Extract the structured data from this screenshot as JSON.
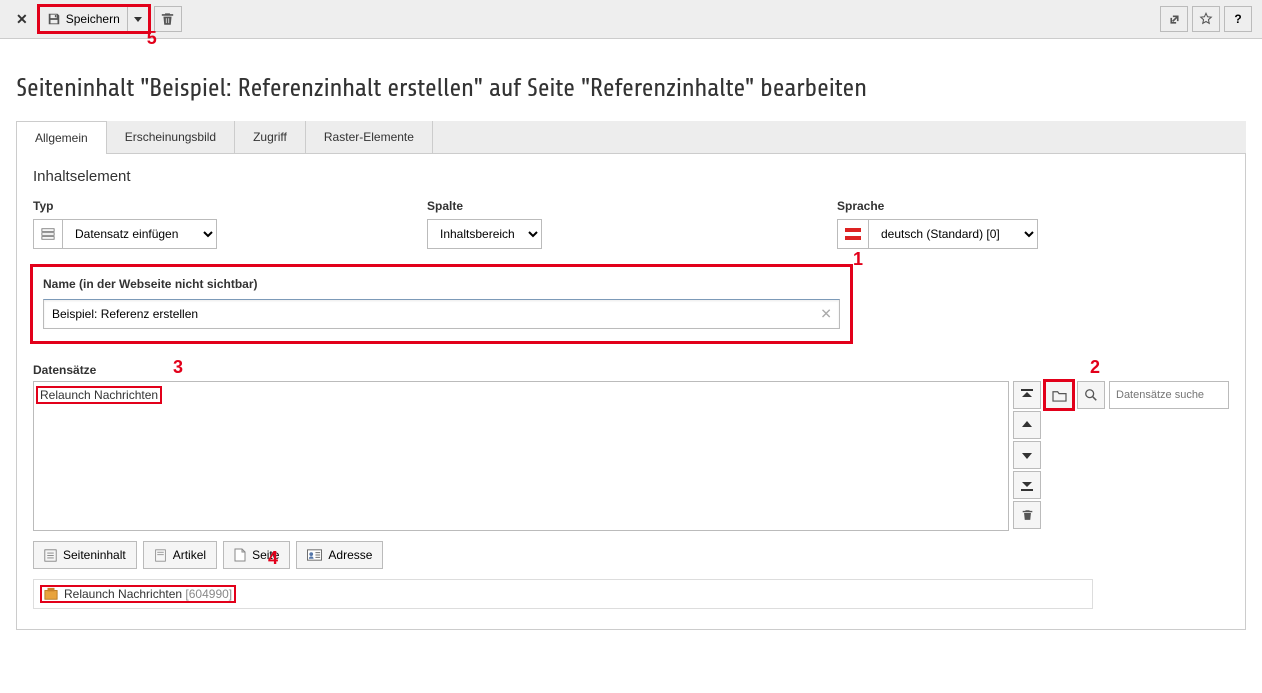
{
  "toolbar": {
    "save_label": "Speichern"
  },
  "page_title": "Seiteninhalt \"Beispiel: Referenzinhalt erstellen\" auf Seite \"Referenzinhalte\" bearbeiten",
  "tabs": [
    "Allgemein",
    "Erscheinungsbild",
    "Zugriff",
    "Raster-Elemente"
  ],
  "section_heading": "Inhaltselement",
  "fields": {
    "type_label": "Typ",
    "type_value": "Datensatz einfügen",
    "column_label": "Spalte",
    "column_value": "Inhaltsbereich",
    "language_label": "Sprache",
    "language_value": "deutsch (Standard) [0]"
  },
  "name": {
    "label": "Name (in der Webseite nicht sichtbar)",
    "value": "Beispiel: Referenz erstellen"
  },
  "records": {
    "label": "Datensätze",
    "items": [
      "Relaunch Nachrichten"
    ],
    "search_placeholder": "Datensätze suche"
  },
  "type_buttons": {
    "seiteninhalt": "Seiteninhalt",
    "artikel": "Artikel",
    "seite": "Seite",
    "adresse": "Adresse"
  },
  "result": {
    "title": "Relaunch Nachrichten",
    "id": "[604990]"
  },
  "annotations": {
    "a1": "1",
    "a2": "2",
    "a3": "3",
    "a4": "4",
    "a5": "5"
  }
}
